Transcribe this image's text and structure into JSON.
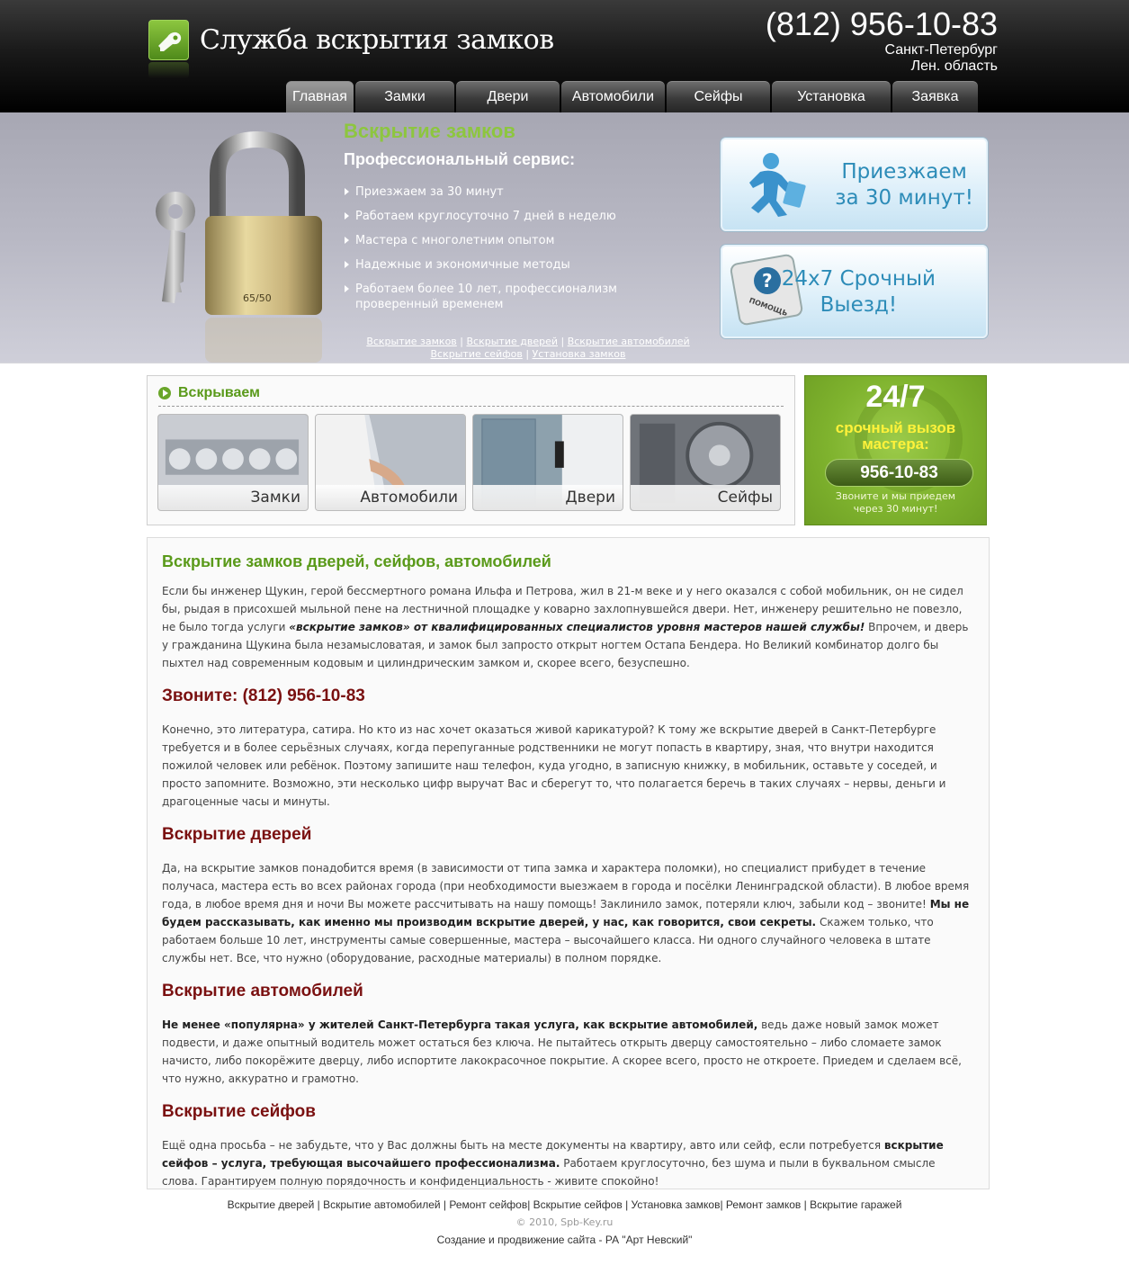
{
  "header": {
    "site_title": "Служба вскрытия замков",
    "phone": "(812) 956-10-83",
    "city_line1": "Санкт-Петербург",
    "city_line2": "Лен. область"
  },
  "nav": [
    {
      "label": "Главная"
    },
    {
      "label": "Замки"
    },
    {
      "label": "Двери"
    },
    {
      "label": "Автомобили"
    },
    {
      "label": "Сейфы"
    },
    {
      "label": "Установка"
    },
    {
      "label": "Заявка"
    }
  ],
  "banner": {
    "heading": "Вскрытие замков",
    "subheading": "Профессиональный сервис:",
    "features": [
      "Приезжаем за 30 минут",
      "Работаем круглосуточно 7 дней в неделю",
      "Мастера с многолетним опытом",
      "Надежные и экономичные методы",
      "Работаем более 10 лет, профессионализм проверенный временем"
    ],
    "links": [
      "Вскрытие замков",
      "Вскрытие дверей",
      "Вскрытие автомобилей",
      "Вскрытие сейфов",
      "Установка замков"
    ],
    "lock_label": "65/50",
    "promo1_line1": "Приезжаем",
    "promo1_line2": "за 30 минут!",
    "promo2_line1": "24x7 Срочный",
    "promo2_line2": "Выезд!",
    "promo2_key_label": "ПОМОЩЬ"
  },
  "services": {
    "title": "Вскрываем",
    "tiles": [
      {
        "label": "Замки"
      },
      {
        "label": "Автомобили"
      },
      {
        "label": "Двери"
      },
      {
        "label": "Сейфы"
      }
    ]
  },
  "callbox": {
    "hours": "24/7",
    "text_line1": "срочный вызов",
    "text_line2": "мастера:",
    "phone": "956-10-83",
    "note_line1": "Звоните и мы приедем",
    "note_line2": "через 30 минут!"
  },
  "article": {
    "title": "Вскрытие замков дверей, сейфов, автомобилей",
    "p1_a": "Если бы инженер Щукин, герой бессмертного романа Ильфа и Петрова, жил в 21-м веке и у него оказался с собой мобильник, он не сидел бы, рыдая в присохшей мыльной пене на лестничной площадке у коварно захлопнувшейся двери. Нет, инженеру решительно не повезло, не было тогда услуги ",
    "p1_bold": "«вскрытие замков» от квалифицированных специалистов уровня мастеров нашей службы!",
    "p1_b": " Впрочем, и дверь у гражданина Щукина была незамысловатая, и замок был запросто открыт ногтем Остапа Бендера. Но Великий комбинатор долго бы пыхтел над современным кодовым и цилиндрическим замком и, скорее всего, безуспешно.",
    "h_call": "Звоните: (812) 956-10-83",
    "p2": "Конечно, это литература, сатира. Но кто из нас хочет оказаться живой карикатурой? К тому же вскрытие дверей в Санкт-Петербурге требуется и в более серьёзных случаях, когда перепуганные родственники не могут попасть в квартиру, зная, что внутри находится пожилой человек или ребёнок. Поэтому запишите наш телефон, куда угодно, в записную книжку, в мобильник, оставьте у соседей, и просто запомните. Возможно, эти несколько цифр выручат Вас и сберегут то, что полагается беречь в таких случаях – нервы, деньги и драгоценные часы и минуты.",
    "h_doors": "Вскрытие дверей",
    "p3_a": "Да, на вскрытие замков понадобится время (в зависимости от типа замка и характера поломки), но специалист прибудет в течение получаса, мастера есть во всех районах города (при необходимости выезжаем в города и посёлки Ленинградской области). В любое время года, в любое время дня и ночи Вы можете рассчитывать на нашу помощь! Заклинило замок, потеряли ключ, забыли код – звоните! ",
    "p3_bold": "Мы не будем рассказывать, как именно мы производим вскрытие дверей, у нас, как говорится, свои секреты.",
    "p3_b": " Скажем только, что работаем больше 10 лет, инструменты самые совершенные, мастера – высочайшего класса. Ни одного случайного человека в штате службы нет. Все, что нужно (оборудование, расходные материалы) в полном порядке.",
    "h_cars": "Вскрытие автомобилей",
    "p4_bold": "Не менее «популярна» у жителей Санкт-Петербурга такая услуга, как вскрытие автомобилей,",
    "p4_b": " ведь даже новый замок может подвести, и даже опытный водитель может остаться без ключа. Не пытайтесь открыть дверцу самостоятельно – либо сломаете замок начисто, либо покорёжите дверцу, либо испортите лакокрасочное покрытие. А скорее всего, просто не откроете. Приедем и сделаем всё, что нужно, аккуратно и грамотно.",
    "h_safes": "Вскрытие сейфов",
    "p5_a": "Ещё одна просьба – не забудьте, что у Вас должны быть на месте документы на квартиру, авто или сейф, если потребуется ",
    "p5_bold": "вскрытие сейфов – услуга, требующая высочайшего профессионализма.",
    "p5_b": " Работаем круглосуточно, без шума и пыли в буквальном смысле слова. Гарантируем полную порядочность и конфиденциальность - живите спокойно!"
  },
  "footer": {
    "links": [
      "Вскрытие дверей",
      "Вскрытие автомобилей",
      "Ремонт сейфов",
      "Вскрытие сейфов",
      "Установка замков",
      "Ремонт замков",
      "Вскрытие гаражей"
    ],
    "copyright": "© 2010, Spb-Key.ru",
    "credits": "Создание и продвижение сайта - РА \"Арт Невский\""
  },
  "colors": {
    "accent_green": "#8dc63f",
    "heading_green": "#5a9a1a",
    "heading_red": "#7a1010",
    "promo_blue": "#2d8cb8",
    "callbox_yellow": "#fff23a"
  }
}
